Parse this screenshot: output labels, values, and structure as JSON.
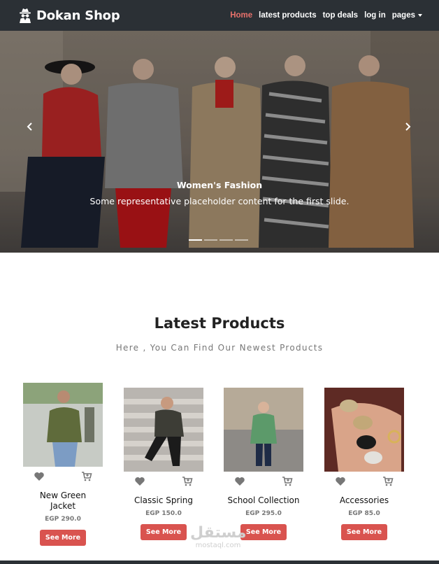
{
  "navbar": {
    "brand": "Dokan Shop",
    "brand_icon": "spy-icon",
    "links": [
      {
        "label": "Home",
        "active": true
      },
      {
        "label": "latest products",
        "active": false
      },
      {
        "label": "top deals",
        "active": false
      },
      {
        "label": "log in",
        "active": false
      },
      {
        "label": "pages",
        "active": false,
        "dropdown": true
      }
    ]
  },
  "carousel": {
    "caption_title": "Women's Fashion",
    "caption_text": "Some representative placeholder content for the first slide.",
    "slide_count": 4,
    "active_slide": 1
  },
  "latest": {
    "title": "Latest Products",
    "subtitle": "Here , You Can Find Our Newest Products"
  },
  "products": [
    {
      "name": "New Green Jacket",
      "price": "EGP 290.0",
      "button": "See More"
    },
    {
      "name": "Classic Spring",
      "price": "EGP 150.0",
      "button": "See More"
    },
    {
      "name": "School Collection",
      "price": "EGP 295.0",
      "button": "See More"
    },
    {
      "name": "Accessories",
      "price": "EGP 85.0",
      "button": "See More"
    }
  ],
  "watermark": {
    "arabic": "مستقل",
    "latin": "mostaql.com"
  },
  "colors": {
    "navbar": "#2b3035",
    "accent": "#e8716b",
    "button": "#d9534f"
  }
}
